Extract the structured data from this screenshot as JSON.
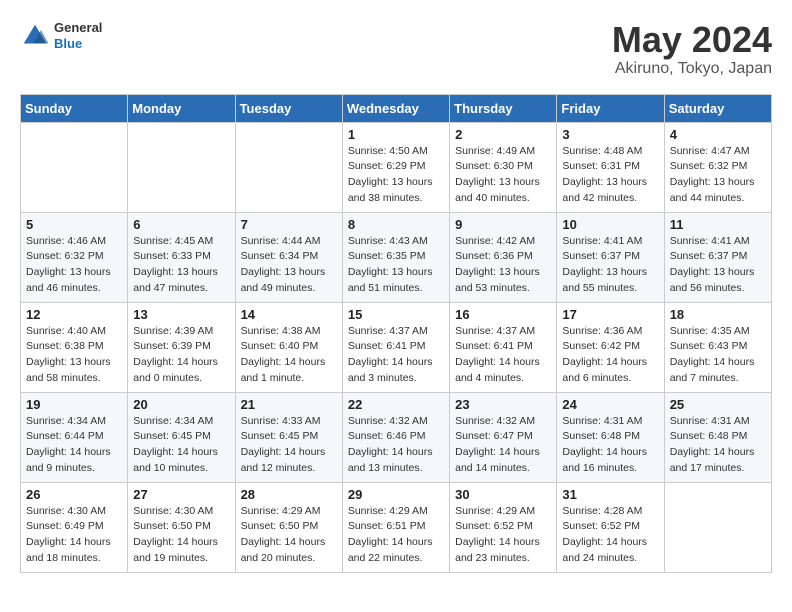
{
  "header": {
    "logo_general": "General",
    "logo_blue": "Blue",
    "title": "May 2024",
    "subtitle": "Akiruno, Tokyo, Japan"
  },
  "calendar": {
    "days_of_week": [
      "Sunday",
      "Monday",
      "Tuesday",
      "Wednesday",
      "Thursday",
      "Friday",
      "Saturday"
    ],
    "weeks": [
      [
        {
          "day": "",
          "info": ""
        },
        {
          "day": "",
          "info": ""
        },
        {
          "day": "",
          "info": ""
        },
        {
          "day": "1",
          "info": "Sunrise: 4:50 AM\nSunset: 6:29 PM\nDaylight: 13 hours\nand 38 minutes."
        },
        {
          "day": "2",
          "info": "Sunrise: 4:49 AM\nSunset: 6:30 PM\nDaylight: 13 hours\nand 40 minutes."
        },
        {
          "day": "3",
          "info": "Sunrise: 4:48 AM\nSunset: 6:31 PM\nDaylight: 13 hours\nand 42 minutes."
        },
        {
          "day": "4",
          "info": "Sunrise: 4:47 AM\nSunset: 6:32 PM\nDaylight: 13 hours\nand 44 minutes."
        }
      ],
      [
        {
          "day": "5",
          "info": "Sunrise: 4:46 AM\nSunset: 6:32 PM\nDaylight: 13 hours\nand 46 minutes."
        },
        {
          "day": "6",
          "info": "Sunrise: 4:45 AM\nSunset: 6:33 PM\nDaylight: 13 hours\nand 47 minutes."
        },
        {
          "day": "7",
          "info": "Sunrise: 4:44 AM\nSunset: 6:34 PM\nDaylight: 13 hours\nand 49 minutes."
        },
        {
          "day": "8",
          "info": "Sunrise: 4:43 AM\nSunset: 6:35 PM\nDaylight: 13 hours\nand 51 minutes."
        },
        {
          "day": "9",
          "info": "Sunrise: 4:42 AM\nSunset: 6:36 PM\nDaylight: 13 hours\nand 53 minutes."
        },
        {
          "day": "10",
          "info": "Sunrise: 4:41 AM\nSunset: 6:37 PM\nDaylight: 13 hours\nand 55 minutes."
        },
        {
          "day": "11",
          "info": "Sunrise: 4:41 AM\nSunset: 6:37 PM\nDaylight: 13 hours\nand 56 minutes."
        }
      ],
      [
        {
          "day": "12",
          "info": "Sunrise: 4:40 AM\nSunset: 6:38 PM\nDaylight: 13 hours\nand 58 minutes."
        },
        {
          "day": "13",
          "info": "Sunrise: 4:39 AM\nSunset: 6:39 PM\nDaylight: 14 hours\nand 0 minutes."
        },
        {
          "day": "14",
          "info": "Sunrise: 4:38 AM\nSunset: 6:40 PM\nDaylight: 14 hours\nand 1 minute."
        },
        {
          "day": "15",
          "info": "Sunrise: 4:37 AM\nSunset: 6:41 PM\nDaylight: 14 hours\nand 3 minutes."
        },
        {
          "day": "16",
          "info": "Sunrise: 4:37 AM\nSunset: 6:41 PM\nDaylight: 14 hours\nand 4 minutes."
        },
        {
          "day": "17",
          "info": "Sunrise: 4:36 AM\nSunset: 6:42 PM\nDaylight: 14 hours\nand 6 minutes."
        },
        {
          "day": "18",
          "info": "Sunrise: 4:35 AM\nSunset: 6:43 PM\nDaylight: 14 hours\nand 7 minutes."
        }
      ],
      [
        {
          "day": "19",
          "info": "Sunrise: 4:34 AM\nSunset: 6:44 PM\nDaylight: 14 hours\nand 9 minutes."
        },
        {
          "day": "20",
          "info": "Sunrise: 4:34 AM\nSunset: 6:45 PM\nDaylight: 14 hours\nand 10 minutes."
        },
        {
          "day": "21",
          "info": "Sunrise: 4:33 AM\nSunset: 6:45 PM\nDaylight: 14 hours\nand 12 minutes."
        },
        {
          "day": "22",
          "info": "Sunrise: 4:32 AM\nSunset: 6:46 PM\nDaylight: 14 hours\nand 13 minutes."
        },
        {
          "day": "23",
          "info": "Sunrise: 4:32 AM\nSunset: 6:47 PM\nDaylight: 14 hours\nand 14 minutes."
        },
        {
          "day": "24",
          "info": "Sunrise: 4:31 AM\nSunset: 6:48 PM\nDaylight: 14 hours\nand 16 minutes."
        },
        {
          "day": "25",
          "info": "Sunrise: 4:31 AM\nSunset: 6:48 PM\nDaylight: 14 hours\nand 17 minutes."
        }
      ],
      [
        {
          "day": "26",
          "info": "Sunrise: 4:30 AM\nSunset: 6:49 PM\nDaylight: 14 hours\nand 18 minutes."
        },
        {
          "day": "27",
          "info": "Sunrise: 4:30 AM\nSunset: 6:50 PM\nDaylight: 14 hours\nand 19 minutes."
        },
        {
          "day": "28",
          "info": "Sunrise: 4:29 AM\nSunset: 6:50 PM\nDaylight: 14 hours\nand 20 minutes."
        },
        {
          "day": "29",
          "info": "Sunrise: 4:29 AM\nSunset: 6:51 PM\nDaylight: 14 hours\nand 22 minutes."
        },
        {
          "day": "30",
          "info": "Sunrise: 4:29 AM\nSunset: 6:52 PM\nDaylight: 14 hours\nand 23 minutes."
        },
        {
          "day": "31",
          "info": "Sunrise: 4:28 AM\nSunset: 6:52 PM\nDaylight: 14 hours\nand 24 minutes."
        },
        {
          "day": "",
          "info": ""
        }
      ]
    ]
  }
}
